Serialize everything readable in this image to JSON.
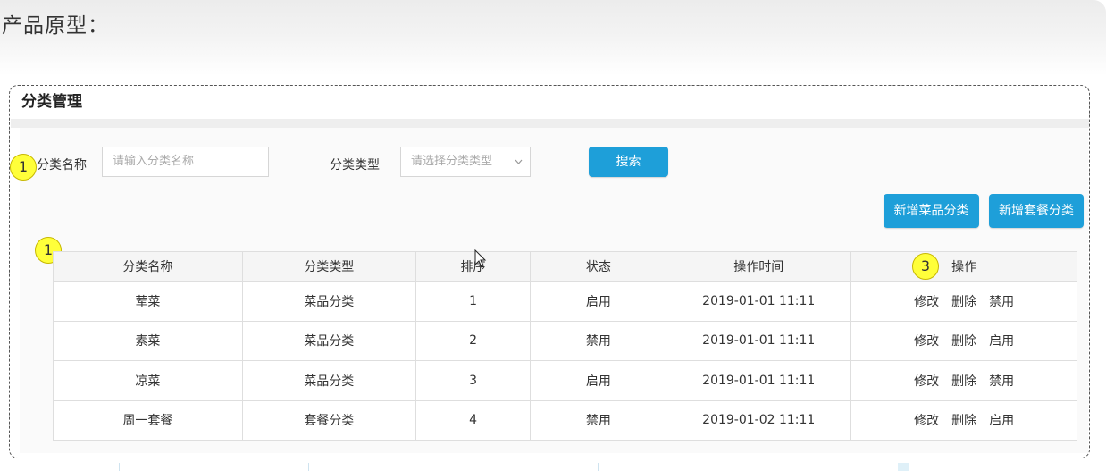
{
  "page_title": "产品原型：",
  "frame_title": "分类管理",
  "search": {
    "name_label": "分类名称",
    "name_placeholder": "请输入分类名称",
    "type_label": "分类类型",
    "type_placeholder": "请选择分类类型",
    "search_button": "搜索"
  },
  "actions": {
    "add_dish_category": "新增菜品分类",
    "add_combo_category": "新增套餐分类"
  },
  "badges": {
    "search_area": "1",
    "table": "1",
    "operations": "3"
  },
  "table": {
    "headers": [
      "分类名称",
      "分类类型",
      "排序",
      "状态",
      "操作时间",
      "操作"
    ],
    "rows": [
      {
        "name": "荤菜",
        "type": "菜品分类",
        "sort": "1",
        "status": "启用",
        "time": "2019-01-01 11:11",
        "ops": [
          "修改",
          "删除",
          "禁用"
        ]
      },
      {
        "name": "素菜",
        "type": "菜品分类",
        "sort": "2",
        "status": "禁用",
        "time": "2019-01-01 11:11",
        "ops": [
          "修改",
          "删除",
          "启用"
        ]
      },
      {
        "name": "凉菜",
        "type": "菜品分类",
        "sort": "3",
        "status": "启用",
        "time": "2019-01-01 11:11",
        "ops": [
          "修改",
          "删除",
          "禁用"
        ]
      },
      {
        "name": "周一套餐",
        "type": "套餐分类",
        "sort": "4",
        "status": "禁用",
        "time": "2019-01-02 11:11",
        "ops": [
          "修改",
          "删除",
          "启用"
        ]
      }
    ]
  },
  "colors": {
    "primary": "#1e9fd9",
    "badge": "#ffff3a"
  },
  "icons": {
    "select_arrow": "chevron-down-icon",
    "pointer": "mouse-cursor-icon"
  }
}
